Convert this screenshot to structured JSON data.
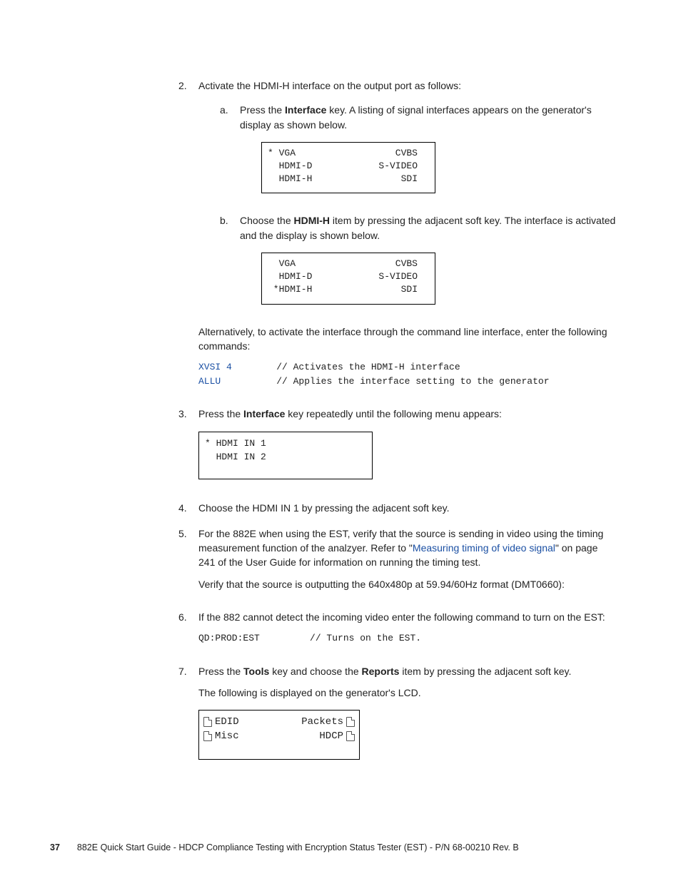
{
  "steps": {
    "s2": {
      "num": "2.",
      "text_a": "Activate the HDMI-H interface on the output port as follows:",
      "sub_a": {
        "num": "a.",
        "prefix": "Press the ",
        "bold": "Interface",
        "suffix": " key. A listing of signal interfaces appears on the generator's display as shown below."
      },
      "lcd1": {
        "r1l": "* VGA",
        "r1r": "CVBS",
        "r2l": "  HDMI-D",
        "r2r": "S-VIDEO",
        "r3l": "  HDMI-H",
        "r3r": "SDI"
      },
      "sub_b": {
        "num": "b.",
        "prefix": "Choose the ",
        "bold": "HDMI-H",
        "suffix": " item by pressing the adjacent soft key. The interface is activated and the display is shown below."
      },
      "lcd2": {
        "r1l": "  VGA",
        "r1r": "CVBS",
        "r2l": "  HDMI-D",
        "r2r": "S-VIDEO",
        "r3l": " *HDMI-H",
        "r3r": "SDI"
      },
      "alt_p": "Alternatively, to activate the interface through the command line interface, enter the following commands:",
      "code1": {
        "line1_cmd": "XVSI 4",
        "line1_comment": "        // Activates the HDMI-H interface",
        "line2_cmd": "ALLU",
        "line2_comment": "          // Applies the interface setting to the generator"
      }
    },
    "s3": {
      "num": "3.",
      "prefix": "Press the ",
      "bold": "Interface",
      "suffix": " key repeatedly until the following menu appears:",
      "lcd": {
        "r1": "* HDMI IN 1",
        "r2": "  HDMI IN 2"
      }
    },
    "s4": {
      "num": "4.",
      "text": "Choose the HDMI IN 1 by pressing the adjacent soft key."
    },
    "s5": {
      "num": "5.",
      "text_a": "For the 882E when using the EST, verify that the source is sending in video using the timing measurement function of the analzyer. Refer to \"",
      "link": "Measuring timing of video signal",
      "text_b": "\" on page 241 of the User Guide for information on running the timing test.",
      "verify": "Verify that the source is outputting the 640x480p at 59.94/60Hz format (DMT0660):"
    },
    "s6": {
      "num": "6.",
      "text": "If the 882 cannot detect the incoming video enter the following command to turn on the EST:",
      "code": "QD:PROD:EST         // Turns on the EST."
    },
    "s7": {
      "num": "7.",
      "prefix": "Press the ",
      "bold1": "Tools",
      "mid": " key and choose the ",
      "bold2": "Reports",
      "suffix": " item by pressing the adjacent soft key.",
      "sub_p": "The following is displayed on the generator's LCD.",
      "lcd": {
        "r1l": "EDID",
        "r1r": "Packets",
        "r2l": "Misc",
        "r2r": "HDCP"
      }
    }
  },
  "footer": {
    "page": "37",
    "text": "882E Quick Start Guide - HDCP Compliance Testing with Encryption Status Tester (EST)    -   P/N 68-00210 Rev. B"
  }
}
